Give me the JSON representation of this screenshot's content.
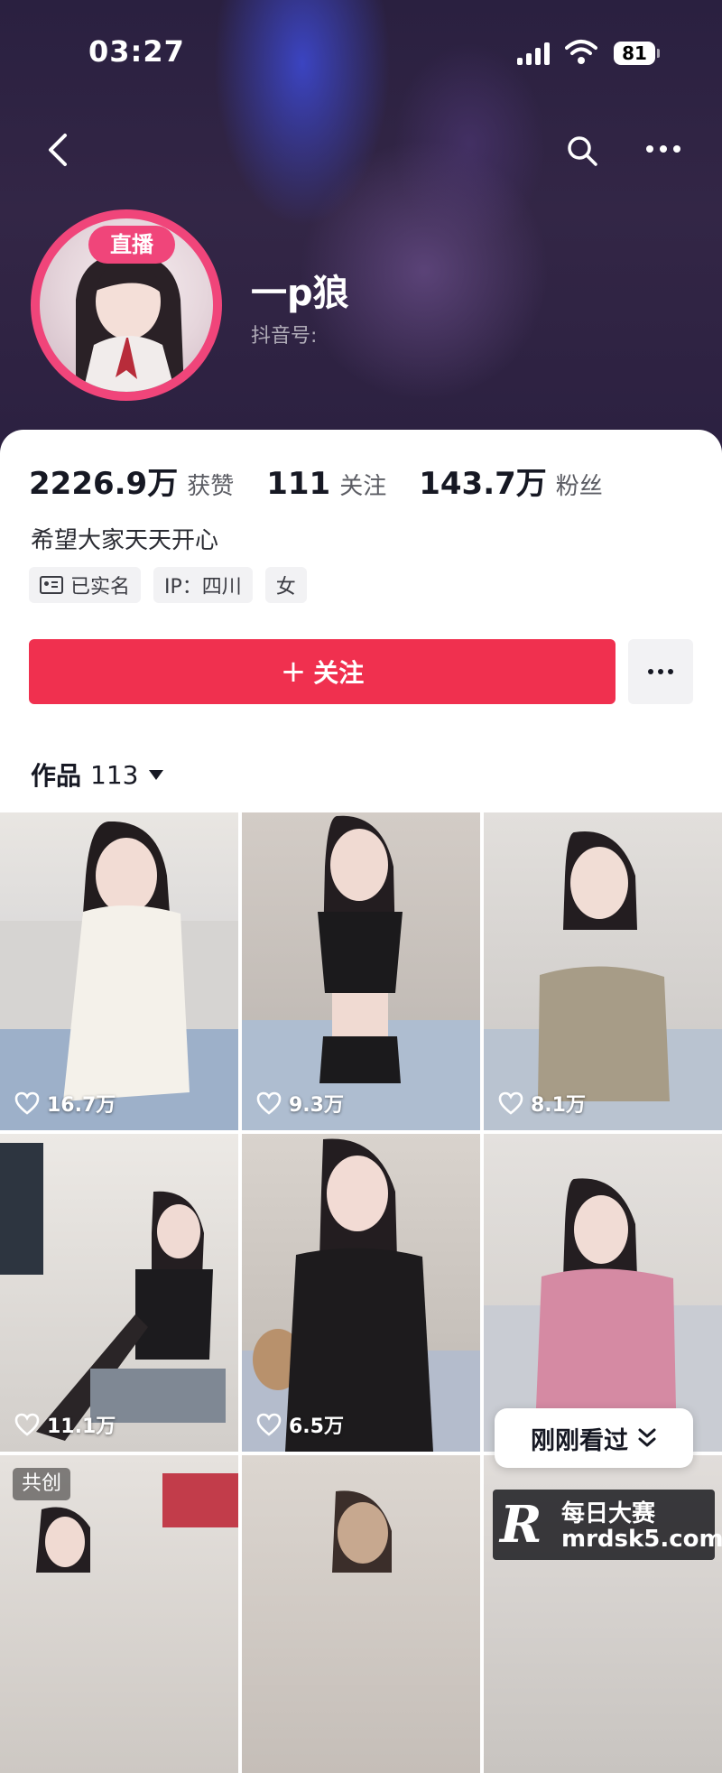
{
  "status_bar": {
    "time": "03:27",
    "battery": "81"
  },
  "profile": {
    "live_badge": "直播",
    "nickname": "一p狼",
    "douyin_id_label": "抖音号:",
    "stats": [
      {
        "value": "2226.9万",
        "label": "获赞"
      },
      {
        "value": "111",
        "label": "关注"
      },
      {
        "value": "143.7万",
        "label": "粉丝"
      }
    ],
    "bio": "希望大家天天开心",
    "tags": [
      "已实名",
      "IP：四川",
      "女"
    ],
    "follow_button": "关注",
    "follow_plus": "+"
  },
  "works": {
    "label": "作品",
    "count": "113"
  },
  "videos": [
    {
      "likes": "16.7万"
    },
    {
      "likes": "9.3万"
    },
    {
      "likes": "8.1万"
    },
    {
      "likes": "11.1万"
    },
    {
      "likes": "6.5万"
    },
    {
      "likes": ""
    },
    {
      "badge": "共创"
    },
    {},
    {}
  ],
  "recent_pill": "刚刚看过",
  "watermark": {
    "top": "每日大赛",
    "bottom": "mrdsk5.com",
    "logo": "R"
  },
  "icons": [
    "back-icon",
    "search-icon",
    "more-icon",
    "id-card-icon",
    "heart-icon",
    "chevron-double-down-icon"
  ],
  "colors": {
    "accent": "#f0304f",
    "live_ring": "#f0457a",
    "header_bg": "#2b2040"
  }
}
